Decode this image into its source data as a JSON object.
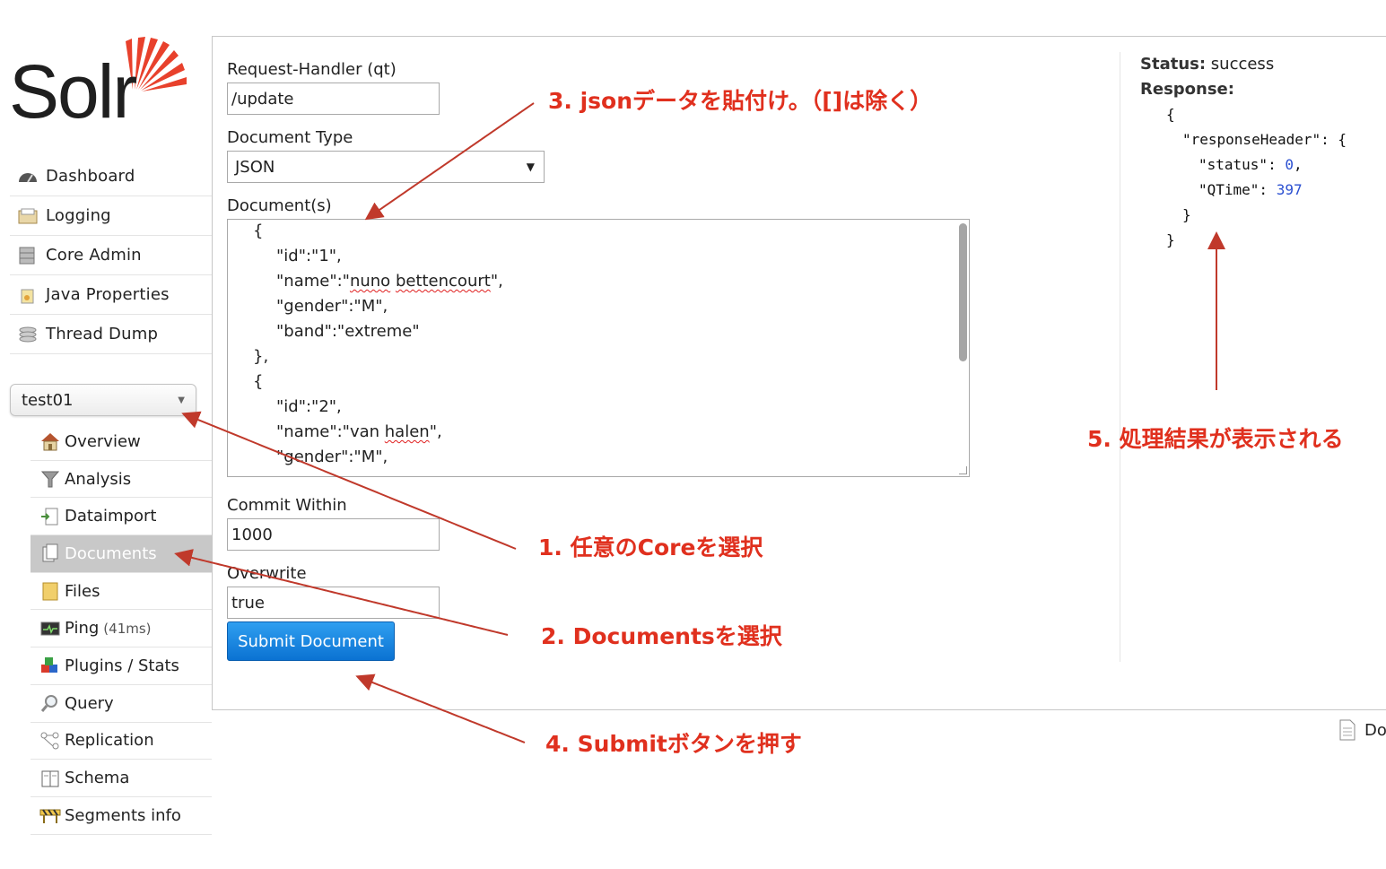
{
  "logo": {
    "text": "Solr"
  },
  "menu": {
    "items": [
      {
        "label": "Dashboard"
      },
      {
        "label": "Logging"
      },
      {
        "label": "Core Admin"
      },
      {
        "label": "Java Properties"
      },
      {
        "label": "Thread Dump"
      }
    ]
  },
  "core_selector": {
    "value": "test01"
  },
  "core_menu": {
    "items": [
      {
        "label": "Overview"
      },
      {
        "label": "Analysis"
      },
      {
        "label": "Dataimport"
      },
      {
        "label": "Documents"
      },
      {
        "label": "Files"
      },
      {
        "label": "Ping",
        "extra": "(41ms)"
      },
      {
        "label": "Plugins / Stats"
      },
      {
        "label": "Query"
      },
      {
        "label": "Replication"
      },
      {
        "label": "Schema"
      },
      {
        "label": "Segments info"
      }
    ]
  },
  "form": {
    "request_handler_label": "Request-Handler (qt)",
    "request_handler_value": "/update",
    "document_type_label": "Document Type",
    "document_type_value": "JSON",
    "documents_label": "Document(s)",
    "documents_lines": [
      "{",
      "\"id\":\"1\",",
      "\"name\":\"nuno bettencourt\",",
      "\"gender\":\"M\",",
      "\"band\":\"extreme\"",
      "},",
      "{",
      "\"id\":\"2\",",
      "\"name\":\"van halen\",",
      "\"gender\":\"M\","
    ],
    "commit_within_label": "Commit Within",
    "commit_within_value": "1000",
    "overwrite_label": "Overwrite",
    "overwrite_value": "true",
    "submit_label": "Submit Document"
  },
  "response": {
    "status_label": "Status:",
    "status_value": "success",
    "response_label": "Response:",
    "lines": [
      "{",
      "\"responseHeader\": {",
      "\"status\": 0,",
      "\"QTime\": 397",
      "}",
      "}"
    ]
  },
  "footer": {
    "doc_link": "Do"
  },
  "annotations": {
    "step1": "1. 任意のCoreを選択",
    "step2": "2. Documentsを選択",
    "step3": "3. jsonデータを貼付け。（[]は除く）",
    "step4": "4. Submitボタンを押す",
    "step5": "5. 処理結果が表示される",
    "color": "#e0301e"
  }
}
